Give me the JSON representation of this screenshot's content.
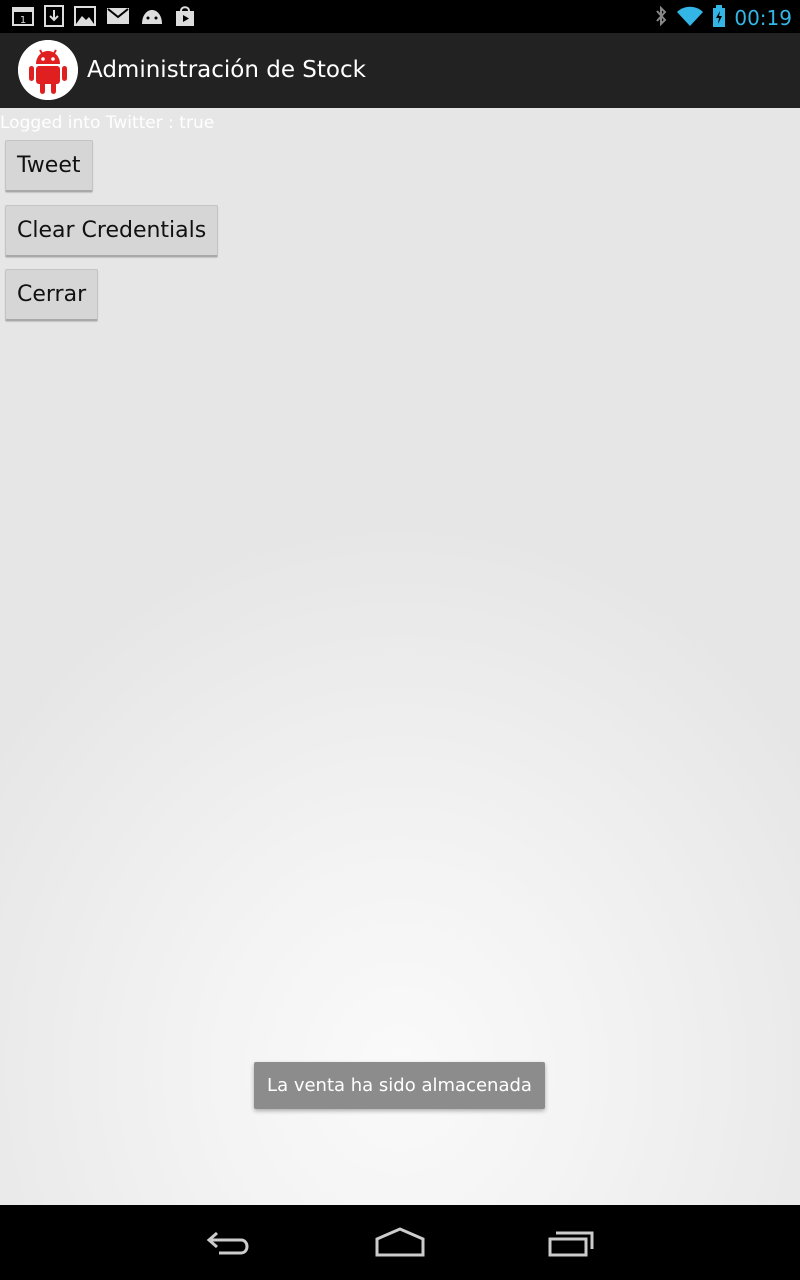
{
  "status_bar": {
    "left_icons": [
      "calendar-icon",
      "download-icon",
      "gallery-icon",
      "gmail-icon",
      "android-debug-icon",
      "play-store-icon"
    ],
    "right_icons": [
      "bluetooth-icon",
      "wifi-icon",
      "battery-charging-icon"
    ],
    "time": "00:19",
    "accent_color": "#33b5e5"
  },
  "action_bar": {
    "title": "Administración de Stock",
    "icon": "android-robot-icon",
    "icon_color": "#e02020"
  },
  "main": {
    "status_text": "Logged into Twitter : true",
    "buttons": {
      "tweet": "Tweet",
      "clear": "Clear Credentials",
      "close": "Cerrar"
    }
  },
  "toast": {
    "message": "La venta ha sido almacenada"
  },
  "nav_bar": {
    "icons": [
      "back-icon",
      "home-icon",
      "recent-apps-icon"
    ]
  }
}
